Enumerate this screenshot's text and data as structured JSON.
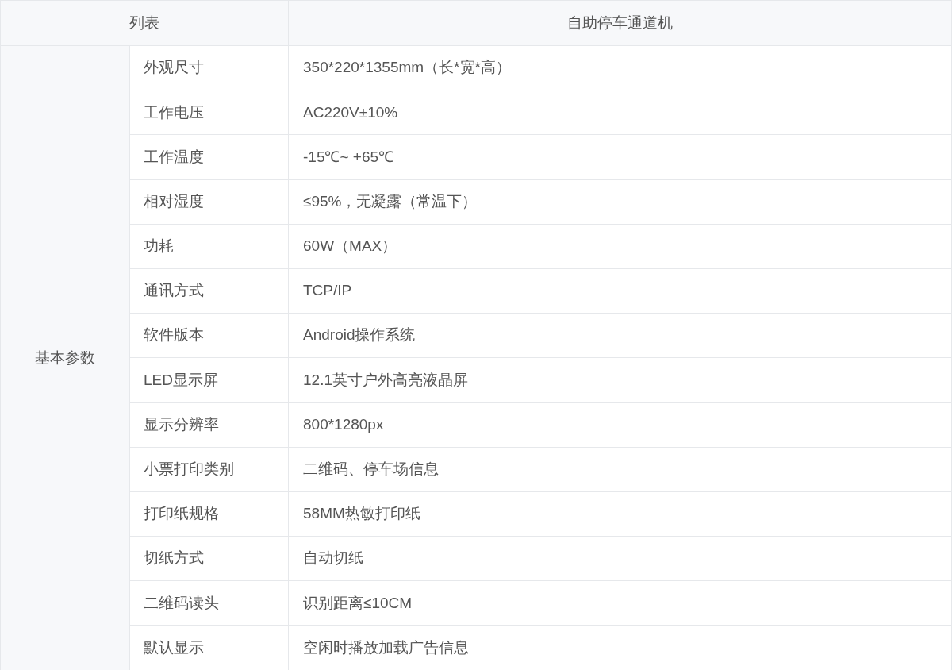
{
  "table": {
    "columns": [
      "列表",
      "自助停车通道机"
    ],
    "group": "基本参数",
    "rows": [
      {
        "label": "外观尺寸",
        "value": "350*220*1355mm（长*宽*高）"
      },
      {
        "label": "工作电压",
        "value": "AC220V±10%"
      },
      {
        "label": "工作温度",
        "value": "-15℃~ +65℃"
      },
      {
        "label": "相对湿度",
        "value": "≤95%，无凝露（常温下）"
      },
      {
        "label": "功耗",
        "value": "60W（MAX）"
      },
      {
        "label": "通讯方式",
        "value": "TCP/IP"
      },
      {
        "label": "软件版本",
        "value": "Android操作系统"
      },
      {
        "label": "LED显示屏",
        "value": "12.1英寸户外高亮液晶屏"
      },
      {
        "label": "显示分辨率",
        "value": "800*1280px"
      },
      {
        "label": "小票打印类别",
        "value": "二维码、停车场信息"
      },
      {
        "label": "打印纸规格",
        "value": "58MM热敏打印纸"
      },
      {
        "label": "切纸方式",
        "value": "自动切纸"
      },
      {
        "label": "二维码读头",
        "value": "识别距离≤10CM"
      },
      {
        "label": "默认显示",
        "value": "空闲时播放加载广告信息"
      }
    ]
  }
}
